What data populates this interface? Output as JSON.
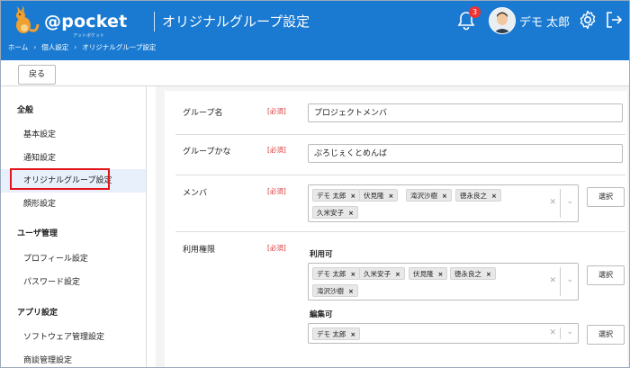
{
  "header": {
    "brand": "@pocket",
    "brand_sub": "アットポケット",
    "page_title": "オリジナルグループ設定",
    "notification_count": "3",
    "user_name": "デモ 太郎",
    "breadcrumb": [
      "ホーム",
      "個人設定",
      "オリジナルグループ設定"
    ]
  },
  "toolbar": {
    "back_label": "戻る"
  },
  "sidebar": {
    "sections": [
      {
        "heading": "全般",
        "items": [
          "基本設定",
          "通知設定",
          "オリジナルグループ設定",
          "顔形設定"
        ]
      },
      {
        "heading": "ユーザ管理",
        "items": [
          "プロフィール設定",
          "パスワード設定"
        ]
      },
      {
        "heading": "アプリ設定",
        "items": [
          "ソフトウェア管理設定",
          "商談管理設定"
        ]
      }
    ],
    "active_item": "オリジナルグループ設定"
  },
  "form": {
    "required_label": "[必須]",
    "select_label": "選択",
    "group_name": {
      "label": "グループ名",
      "value": "プロジェクトメンバ"
    },
    "group_kana": {
      "label": "グループかな",
      "value": "ぷろじぇくとめんば"
    },
    "members": {
      "label": "メンバ",
      "chips": [
        "デモ 太郎",
        "伏見隆",
        "滝沢沙樹",
        "徳永良之",
        "久米安子"
      ]
    },
    "permissions": {
      "label": "利用権限",
      "usable": {
        "label": "利用可",
        "chips": [
          "デモ 太郎",
          "久米安子",
          "伏見隆",
          "徳永良之",
          "滝沢沙樹"
        ]
      },
      "editable": {
        "label": "編集可",
        "chips": [
          "デモ 太郎"
        ]
      }
    }
  },
  "colors": {
    "header_bg": "#1a7ad1",
    "highlight_box": "#e3151a",
    "required": "#dd3333"
  }
}
